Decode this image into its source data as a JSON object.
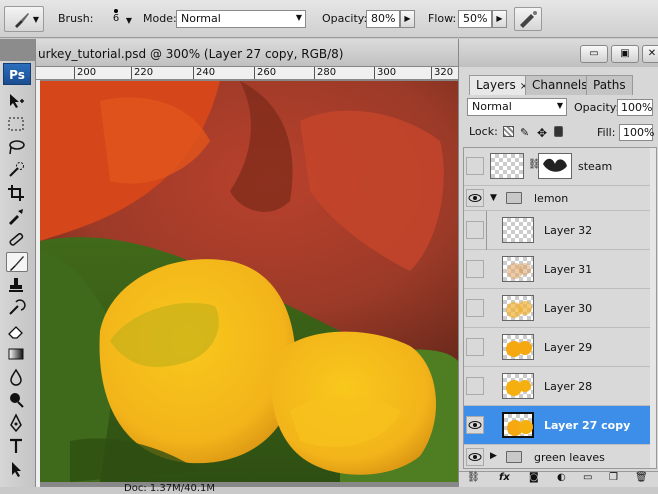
{
  "options_bar": {
    "brush_label": "Brush:",
    "brush_size": "6",
    "mode_label": "Mode:",
    "mode_value": "Normal",
    "opacity_label": "Opacity:",
    "opacity_value": "80%",
    "flow_label": "Flow:",
    "flow_value": "50%"
  },
  "toolbox": {
    "logo": "Ps"
  },
  "document": {
    "title": "urkey_tutorial.psd @ 300% (Layer 27 copy, RGB/8)",
    "ruler_ticks": [
      "200",
      "220",
      "240",
      "260",
      "280",
      "300",
      "320"
    ],
    "doc_info": "Doc: 1.37M/40.1M"
  },
  "layers_panel": {
    "tabs": [
      {
        "label": "Layers",
        "close": "×"
      },
      {
        "label": "Channels"
      },
      {
        "label": "Paths"
      }
    ],
    "blend_mode": "Normal",
    "opacity_label": "Opacity:",
    "opacity_value": "100%",
    "lock_label": "Lock:",
    "fill_label": "Fill:",
    "fill_value": "100%",
    "layers": [
      {
        "name": "steam",
        "visible": false,
        "type": "layer-mask"
      },
      {
        "name": "lemon",
        "visible": true,
        "type": "group-open"
      },
      {
        "name": "Layer 32",
        "visible": false,
        "type": "layer"
      },
      {
        "name": "Layer 31",
        "visible": false,
        "type": "layer"
      },
      {
        "name": "Layer 30",
        "visible": false,
        "type": "layer"
      },
      {
        "name": "Layer 29",
        "visible": false,
        "type": "layer"
      },
      {
        "name": "Layer 28",
        "visible": false,
        "type": "layer"
      },
      {
        "name": "Layer 27 copy",
        "visible": true,
        "type": "layer",
        "selected": true
      },
      {
        "name": "green leaves",
        "visible": true,
        "type": "group-closed"
      }
    ]
  },
  "colors": {
    "selection": "#3d8ee8",
    "lemon": "#f0b81a",
    "tomato": "#c9452a",
    "leaves": "#3f6a1c"
  }
}
